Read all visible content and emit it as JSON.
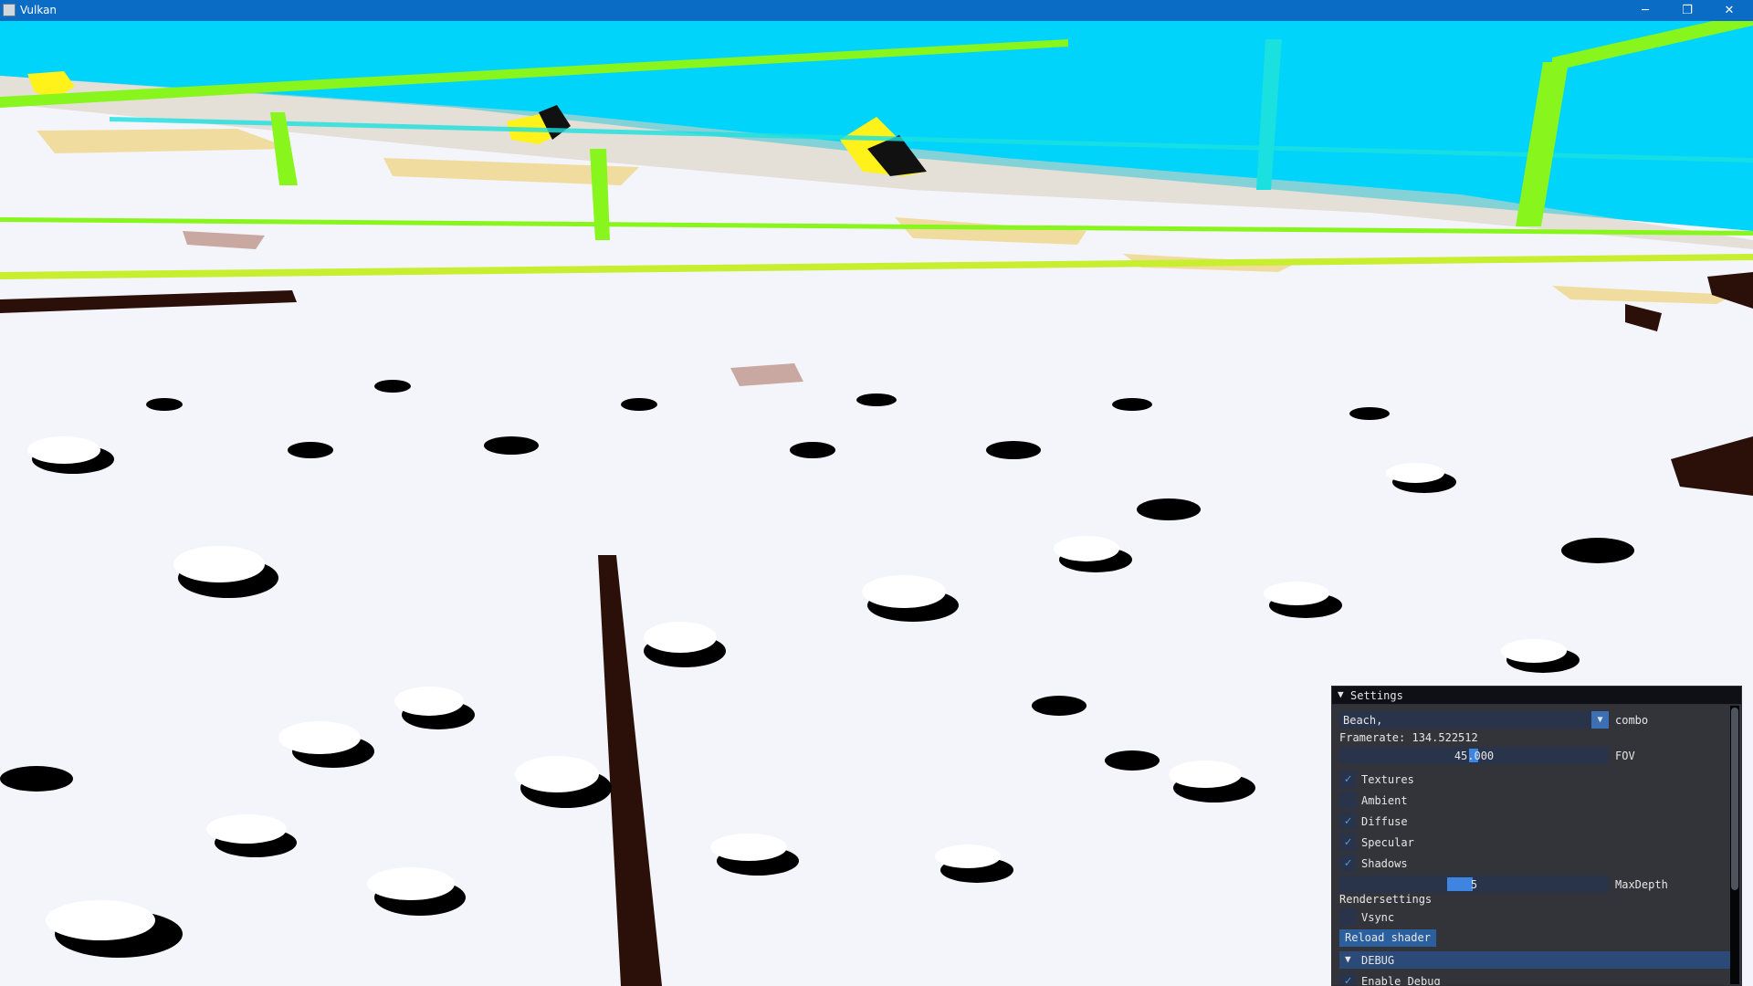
{
  "window": {
    "title": "Vulkan",
    "minimize_glyph": "─",
    "maximize_glyph": "❐",
    "close_glyph": "✕"
  },
  "settings": {
    "title": "Settings",
    "collapse_glyph": "▼",
    "scene_combo": {
      "value": "Beach,",
      "label": "combo",
      "arrow_glyph": "▼"
    },
    "framerate_text": "Framerate: 134.522512",
    "fov": {
      "value": "45.000",
      "label": "FOV"
    },
    "checkboxes": [
      {
        "label": "Textures",
        "checked": true
      },
      {
        "label": "Ambient",
        "checked": false
      },
      {
        "label": "Diffuse",
        "checked": true
      },
      {
        "label": "Specular",
        "checked": true
      },
      {
        "label": "Shadows",
        "checked": true
      }
    ],
    "max_depth": {
      "value": "5",
      "label": "MaxDepth"
    },
    "render_settings_label": "Rendersettings",
    "vsync": {
      "label": "Vsync",
      "checked": false
    },
    "reload_button": "Reload shader",
    "debug_header": "DEBUG",
    "enable_debug": {
      "label": "Enable Debug",
      "checked": true
    },
    "check_glyph": "✓"
  },
  "colors": {
    "titlebar": "#0a6cc4",
    "sky": "#00d4fb",
    "ground": "#f4f4fb",
    "beam_green": "#88f51c",
    "beam_cyan": "#1ae0e0",
    "sand": "#f1dca0",
    "wood": "#2a1008",
    "yellow": "#fff21a"
  }
}
